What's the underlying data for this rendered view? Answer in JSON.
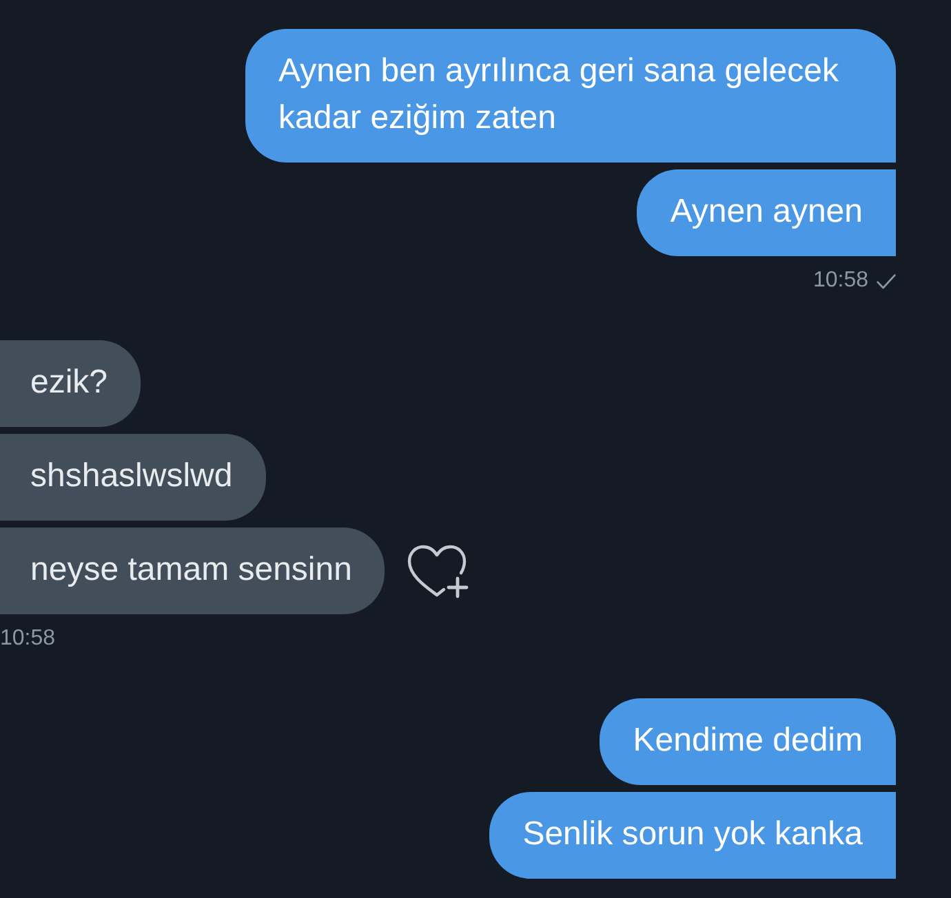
{
  "groups": [
    {
      "kind": "outgoing",
      "messages": [
        "Aynen ben ayrılınca geri sana gelecek kadar eziğim zaten",
        "Aynen aynen"
      ],
      "time": "10:58",
      "sent": true
    },
    {
      "kind": "incoming",
      "messages": [
        "ezik?",
        "shshaslwslwd",
        "neyse tamam sensinn"
      ],
      "time": "10:58"
    },
    {
      "kind": "outgoing",
      "messages": [
        "Kendime dedim",
        "Senlik sorun yok kanka"
      ]
    }
  ]
}
